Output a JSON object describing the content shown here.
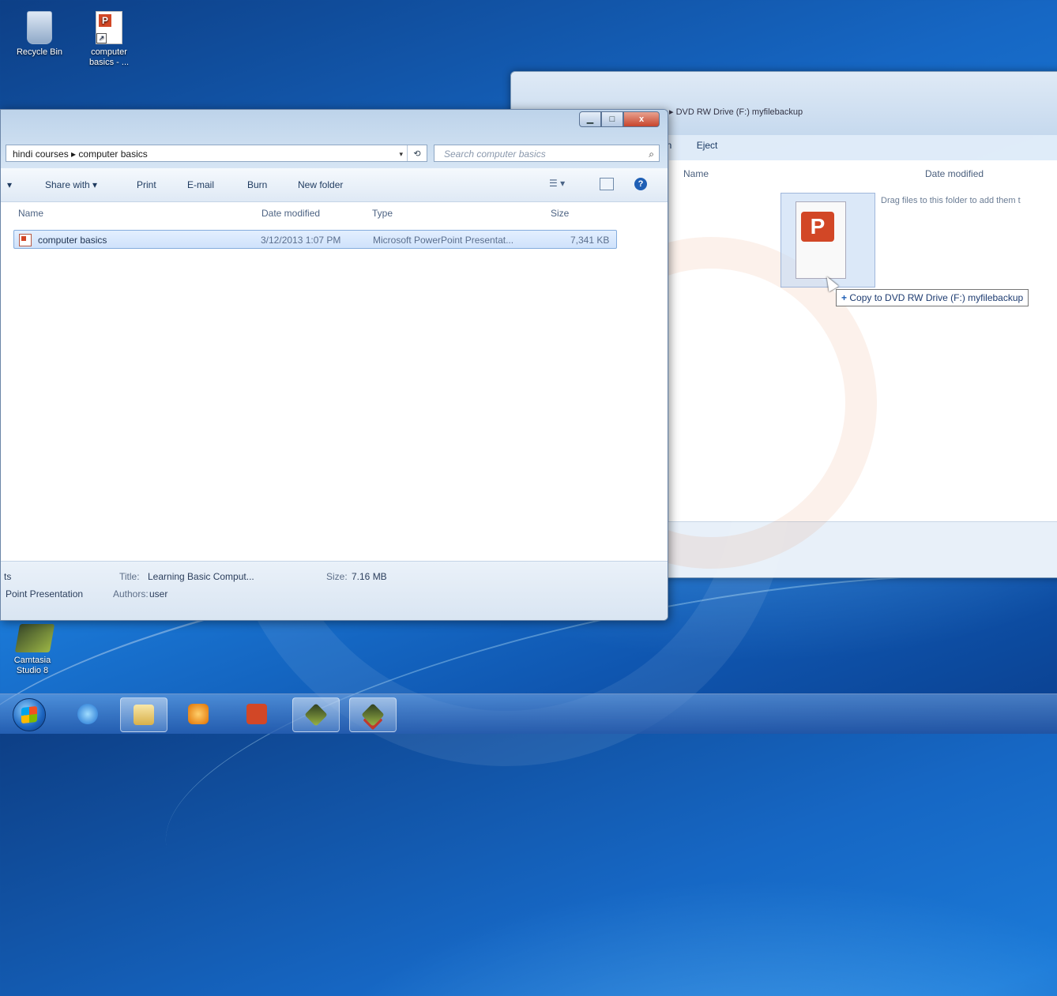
{
  "desktop": {
    "icons": [
      {
        "label": "Recycle Bin"
      },
      {
        "label": "computer basics - ..."
      },
      {
        "label": "Camtasia Studio 8"
      }
    ]
  },
  "back_window": {
    "address": "▸  DVD RW Drive (F:) myfilebackup",
    "toolbar": {
      "left_partial": "on",
      "eject": "Eject"
    },
    "columns": {
      "name": "Name",
      "date_modified": "Date modified"
    },
    "empty_hint": "Drag files to this folder to add them t",
    "drag_tooltip": "Copy to DVD RW Drive (F:) myfilebackup",
    "tooltip_icon": "+"
  },
  "front_window": {
    "caption": {
      "minimize": "▁",
      "maximize": "□",
      "close": "x"
    },
    "breadcrumb": "hindi courses  ▸  computer basics",
    "dropdown_glyph": "▾",
    "refresh_glyph": "⟲",
    "search_placeholder": "Search computer basics",
    "search_glyph": "⌕",
    "cmd": {
      "organize_partial": "▾",
      "share_with": "Share with  ▾",
      "print": "Print",
      "email": "E-mail",
      "burn": "Burn",
      "new_folder": "New folder",
      "views": "☰  ▾",
      "help": "?"
    },
    "columns": {
      "name": "Name",
      "date_modified": "Date modified",
      "type": "Type",
      "size": "Size"
    },
    "files": [
      {
        "name": "computer basics",
        "date": "3/12/2013 1:07 PM",
        "type": "Microsoft PowerPoint Presentat...",
        "size": "7,341 KB"
      }
    ],
    "details": {
      "name_partial": "ts",
      "type_partial": "Point Presentation",
      "title_label": "Title:",
      "title_value": "Learning Basic Comput...",
      "authors_label": "Authors:",
      "authors_value": "user",
      "size_label": "Size:",
      "size_value": "7.16 MB"
    }
  },
  "taskbar": {
    "items": [
      "start",
      "internet-explorer",
      "windows-explorer",
      "media-player",
      "powerpoint",
      "camtasia",
      "camtasia-recorder"
    ]
  }
}
